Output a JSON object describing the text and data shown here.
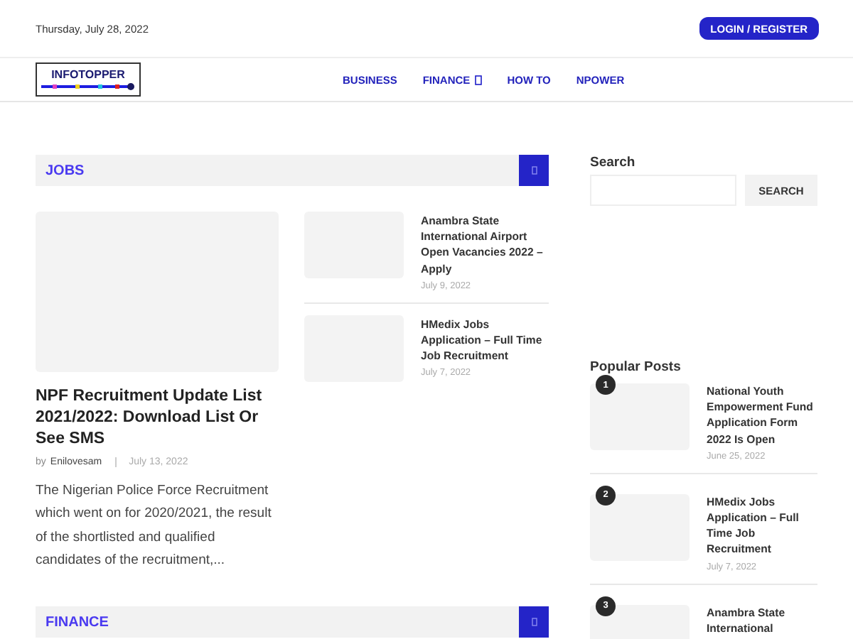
{
  "top_bar": {
    "date": "Thursday, July 28, 2022",
    "login_button": "LOGIN / REGISTER"
  },
  "logo": {
    "text": "INFOTOPPER"
  },
  "nav": [
    {
      "label": "BUSINESS",
      "has_dropdown": false
    },
    {
      "label": "FINANCE",
      "has_dropdown": true
    },
    {
      "label": "HOW TO",
      "has_dropdown": false
    },
    {
      "label": "NPOWER",
      "has_dropdown": false
    }
  ],
  "sections": [
    {
      "title": "JOBS",
      "featured": {
        "title": "NPF Recruitment Update List 2021/2022: Download List Or See SMS",
        "by": "by",
        "author": "Enilovesam",
        "date": "July 13, 2022",
        "excerpt": "The Nigerian Police Force Recruitment which went on for 2020/2021, the result of the shortlisted and qualified candidates of the recruitment,..."
      },
      "posts": [
        {
          "title": "Anambra State International Airport Open Vacancies 2022 – Apply",
          "date": "July 9, 2022"
        },
        {
          "title": "HMedix Jobs Application – Full Time Job Recruitment",
          "date": "July 7, 2022"
        }
      ]
    },
    {
      "title": "FINANCE"
    }
  ],
  "sidebar": {
    "search_label": "Search",
    "search_button": "SEARCH",
    "popular_title": "Popular Posts",
    "popular": [
      {
        "rank": "1",
        "title": "National Youth Empowerment Fund Application Form 2022 Is Open",
        "date": "June 25, 2022"
      },
      {
        "rank": "2",
        "title": "HMedix Jobs Application – Full Time Job Recruitment",
        "date": "July 7, 2022"
      },
      {
        "rank": "3",
        "title": "Anambra State International"
      }
    ]
  }
}
